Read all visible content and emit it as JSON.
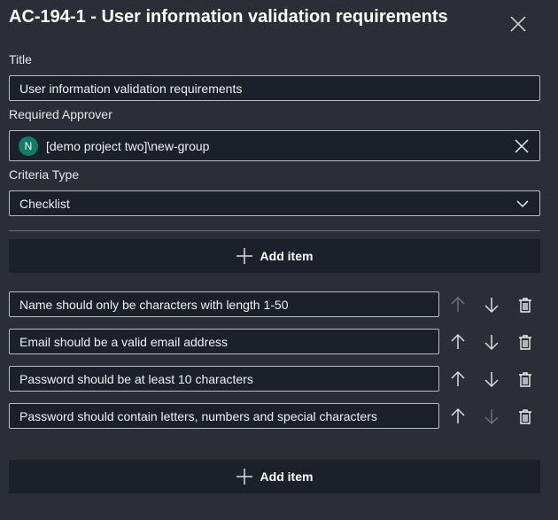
{
  "header": {
    "title": "AC-194-1 - User information validation requirements"
  },
  "form": {
    "title_label": "Title",
    "title_value": "User information validation requirements",
    "approver_label": "Required Approver",
    "approver_initial": "N",
    "approver_value": "[demo project two]\\new-group",
    "criteria_label": "Criteria Type",
    "criteria_value": "Checklist"
  },
  "add_item_label": "Add item",
  "items": [
    {
      "text": "Name should only be characters with length 1-50",
      "up_enabled": false,
      "down_enabled": true
    },
    {
      "text": "Email should be a valid email address",
      "up_enabled": true,
      "down_enabled": true
    },
    {
      "text": "Password should be at least 10 characters",
      "up_enabled": true,
      "down_enabled": true
    },
    {
      "text": "Password should contain letters, numbers and special characters",
      "up_enabled": true,
      "down_enabled": false
    }
  ],
  "colors": {
    "background": "#2b2e37",
    "input": "#1c202a",
    "avatar": "#0f7b68"
  }
}
